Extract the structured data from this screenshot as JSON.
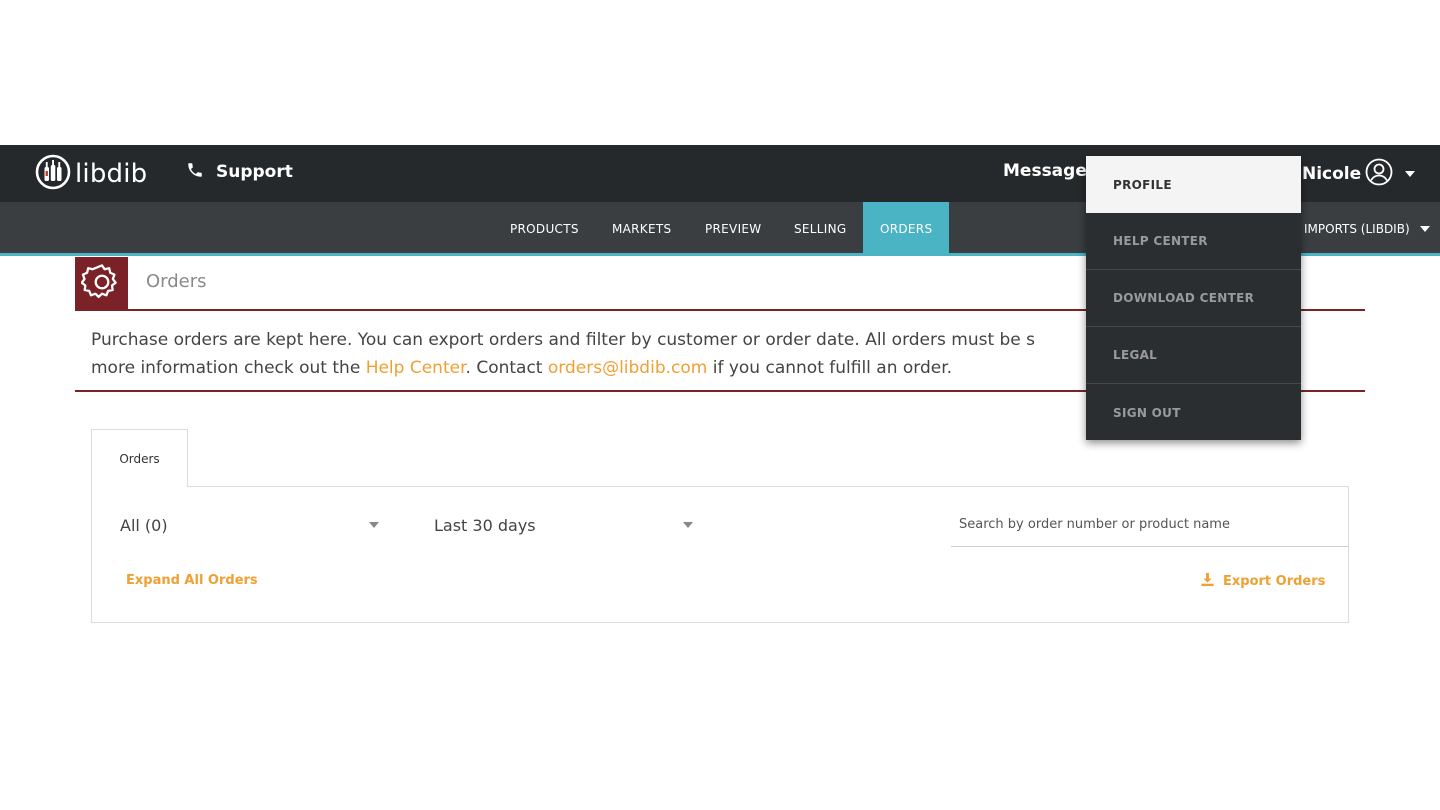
{
  "header": {
    "logo_text": "libdib",
    "support_label": "Support",
    "messages_label": "Messages",
    "user_name": "Nicole"
  },
  "nav": {
    "items": [
      {
        "label": "PRODUCTS"
      },
      {
        "label": "MARKETS"
      },
      {
        "label": "PREVIEW"
      },
      {
        "label": "SELLING"
      },
      {
        "label": "ORDERS",
        "active": true
      }
    ],
    "account_label": "IMPORTS (LIBDIB)"
  },
  "page": {
    "title": "Orders",
    "intro": {
      "part1": "Purchase orders are kept here. You can export orders and filter by customer or order date. All orders must be s",
      "part2": "more information check out the ",
      "help_link": "Help Center",
      "part3": ". Contact ",
      "email_link": "orders@libdib.com",
      "part4": " if you cannot fulfill an order."
    }
  },
  "orders": {
    "tab_label": "Orders",
    "customer_filter": "All (0)",
    "date_filter": "Last 30 days",
    "search_placeholder": "Search by order number or product name",
    "expand_label": "Expand All Orders",
    "export_label": "Export Orders"
  },
  "user_menu": {
    "items": [
      {
        "label": "PROFILE",
        "active": true
      },
      {
        "label": "HELP CENTER"
      },
      {
        "label": "DOWNLOAD CENTER"
      },
      {
        "label": "LEGAL"
      },
      {
        "label": "SIGN OUT"
      }
    ]
  },
  "colors": {
    "topbar": "#26292b",
    "navbar": "#3a3e41",
    "accent_teal": "#4ab3c4",
    "brand_maroon": "#7a2228",
    "link_orange": "#f0a033"
  },
  "icons": {
    "logo": "wine-bottles-logo-icon",
    "support": "phone-icon",
    "user": "user-circle-icon",
    "page": "gear-icon",
    "export": "download-icon"
  }
}
